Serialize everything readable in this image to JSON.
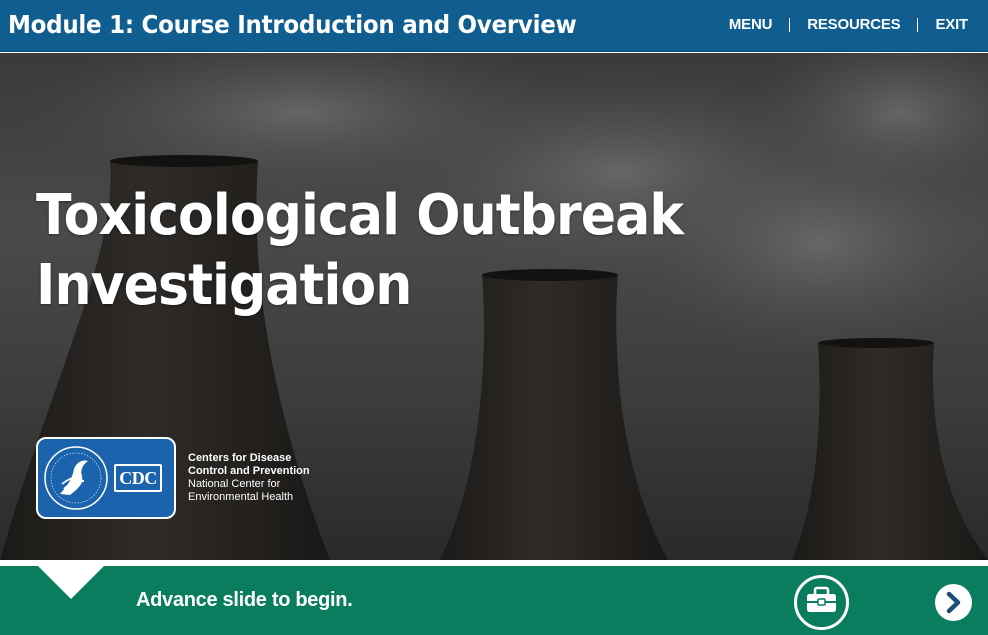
{
  "header": {
    "title": "Module 1: Course Introduction and Overview",
    "nav": {
      "menu": "MENU",
      "resources": "RESOURCES",
      "exit": "EXIT"
    }
  },
  "hero": {
    "title_line1": "Toxicological Outbreak",
    "title_line2": "Investigation"
  },
  "logo": {
    "line1": "Centers for Disease",
    "line2": "Control and Prevention",
    "line3": "National Center for",
    "line4": "Environmental Health",
    "badge_text": "CDC",
    "seal_icon": "hhs-eagle-icon"
  },
  "footer": {
    "instruction": "Advance slide to begin.",
    "toolkit_icon": "toolbox-icon",
    "next_icon": "chevron-right-icon"
  },
  "colors": {
    "header_bg": "#0f5e8f",
    "footer_bg": "#0a7d5f",
    "logo_bg": "#1b63ad"
  }
}
